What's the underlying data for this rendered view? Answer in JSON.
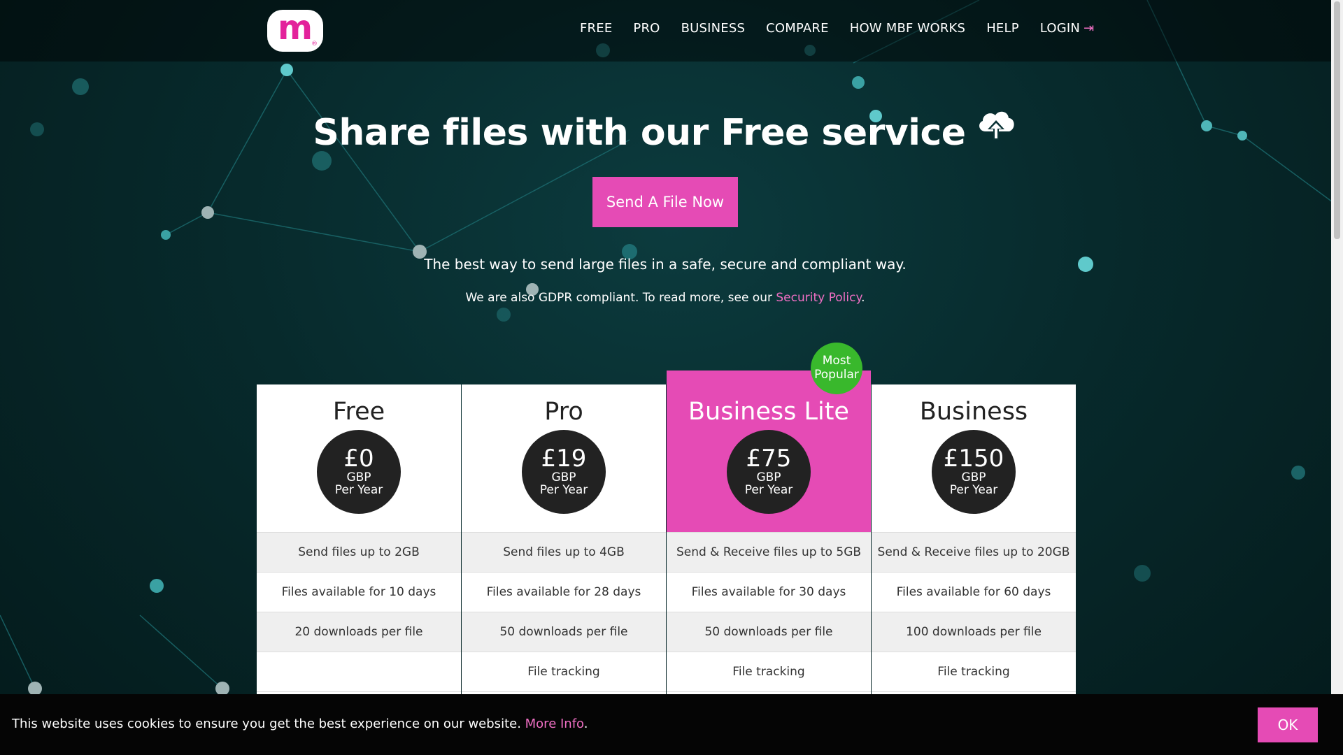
{
  "brand": {
    "logo_letter": "m",
    "logo_mark": "®",
    "accent": "#e54bb5",
    "green": "#39b82c"
  },
  "nav": {
    "items": [
      "FREE",
      "PRO",
      "BUSINESS",
      "COMPARE",
      "HOW MBF WORKS",
      "HELP"
    ],
    "login": "LOGIN"
  },
  "hero": {
    "title": "Share files with our Free service",
    "cta": "Send A File Now",
    "tagline": "The best way to send large files in a safe, secure and compliant way.",
    "gdpr_prefix": "We are also GDPR compliant. To read more, see our ",
    "gdpr_link": "Security Policy",
    "gdpr_suffix": "."
  },
  "badge": {
    "line1": "Most",
    "line2": "Popular"
  },
  "plans": [
    {
      "name": "Free",
      "amount": "£0",
      "currency": "GBP",
      "period": "Per Year",
      "features": [
        "Send files up to 2GB",
        "Files available for 10 days",
        "20 downloads per file",
        ""
      ]
    },
    {
      "name": "Pro",
      "amount": "£19",
      "currency": "GBP",
      "period": "Per Year",
      "features": [
        "Send files up to 4GB",
        "Files available for 28 days",
        "50 downloads per file",
        "File tracking"
      ]
    },
    {
      "name": "Business Lite",
      "amount": "£75",
      "currency": "GBP",
      "period": "Per Year",
      "features": [
        "Send & Receive files up to 5GB",
        "Files available for 30 days",
        "50 downloads per file",
        "File tracking"
      ]
    },
    {
      "name": "Business",
      "amount": "£150",
      "currency": "GBP",
      "period": "Per Year",
      "features": [
        "Send & Receive files up to 20GB",
        "Files available for 60 days",
        "100 downloads per file",
        "File tracking"
      ]
    }
  ],
  "cookie": {
    "text": "This website uses cookies to ensure you get the best experience on our website. ",
    "link": "More Info",
    "suffix": ".",
    "ok": "OK"
  }
}
